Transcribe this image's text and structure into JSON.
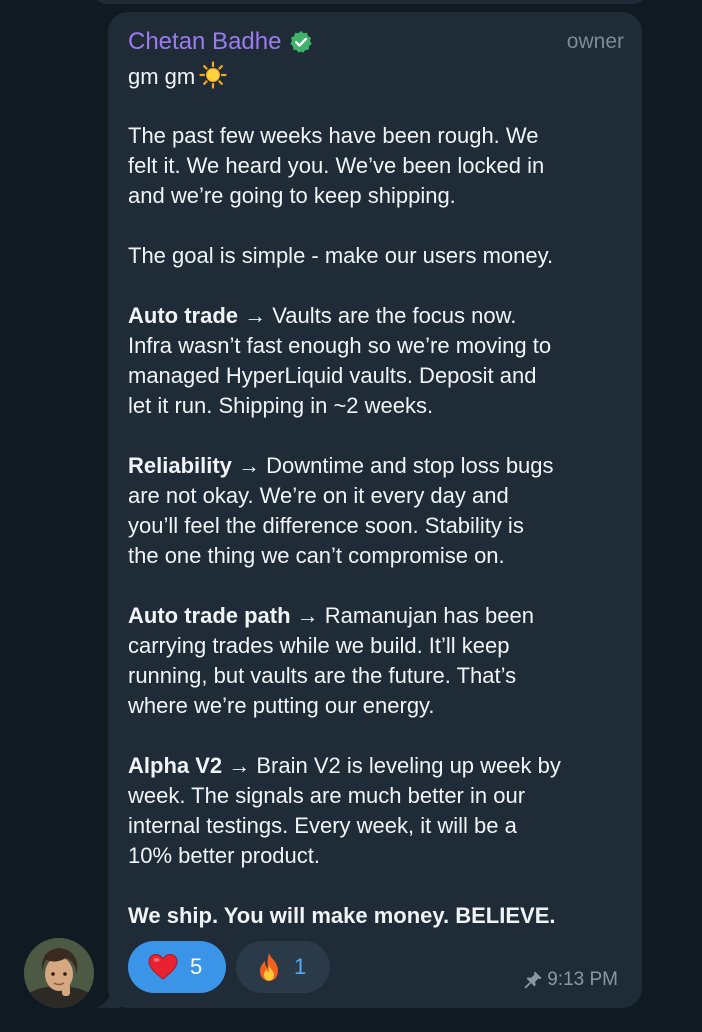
{
  "message": {
    "author": "Chetan Badhe",
    "role": "owner",
    "lines": [
      {
        "text": "gm gm",
        "emoji": "sun-icon"
      },
      {
        "blank": true
      },
      {
        "text": "The past few weeks have been rough. We"
      },
      {
        "text": "felt it. We heard you. We’ve been locked in"
      },
      {
        "text": "and we’re going to keep shipping."
      },
      {
        "blank": true
      },
      {
        "text": "The goal is simple - make our users money."
      },
      {
        "blank": true
      },
      {
        "bold": "Auto trade",
        "text": " → Vaults are the focus now."
      },
      {
        "text": "Infra wasn’t fast enough so we’re moving to"
      },
      {
        "text": "managed HyperLiquid vaults. Deposit and"
      },
      {
        "text": "let it run. Shipping in ~2 weeks."
      },
      {
        "blank": true
      },
      {
        "bold": "Reliability",
        "text": " → Downtime and stop loss bugs"
      },
      {
        "text": "are not okay. We’re on it every day and"
      },
      {
        "text": "you’ll feel the difference soon. Stability is"
      },
      {
        "text": "the one thing we can’t compromise on."
      },
      {
        "blank": true
      },
      {
        "bold": "Auto trade path",
        "text": " → Ramanujan has been"
      },
      {
        "text": "carrying trades while we build. It’ll keep"
      },
      {
        "text": "running, but vaults are the future. That’s"
      },
      {
        "text": "where we’re putting our energy."
      },
      {
        "blank": true
      },
      {
        "bold": "Alpha V2",
        "text": " → Brain V2 is leveling up week by"
      },
      {
        "text": "week. The signals are much better in our"
      },
      {
        "text": "internal testings. Every week, it will be a"
      },
      {
        "text": "10% better product."
      },
      {
        "blank": true
      },
      {
        "bold": "We ship. You will make money. BELIEVE."
      }
    ],
    "reactions": [
      {
        "emoji": "heart-icon",
        "count": "5"
      },
      {
        "emoji": "fire-icon",
        "count": "1"
      }
    ],
    "time": "9:13 PM",
    "pinned": true
  },
  "colors": {
    "background": "#0f1a23",
    "bubble": "#1f2c37",
    "author": "#9c7bf0",
    "verified": "#3fb36b",
    "reaction_active": "#3a94e8",
    "reaction_inactive": "#2b3a49"
  }
}
